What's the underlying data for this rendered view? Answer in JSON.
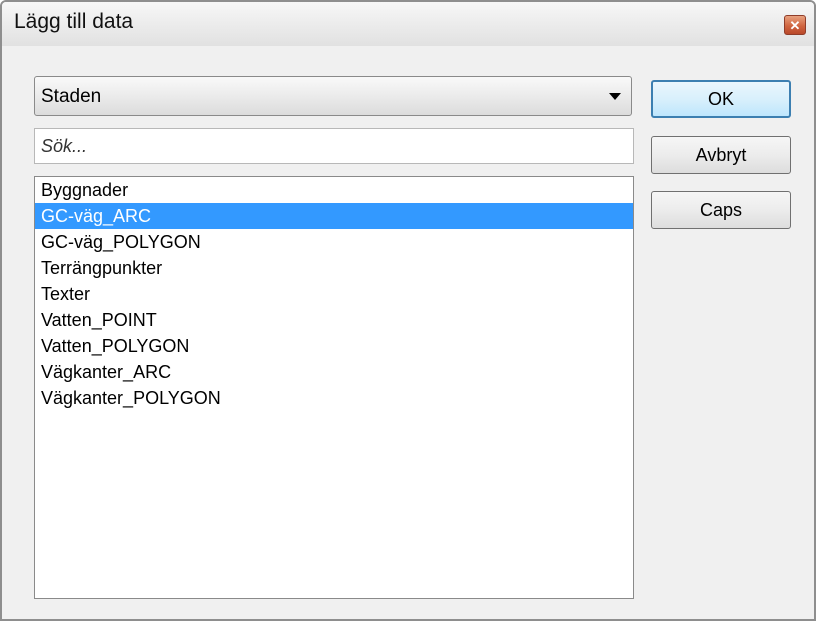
{
  "window": {
    "title": "Lägg till data",
    "close_symbol": "✕"
  },
  "source_combo": {
    "selected_value": "Staden"
  },
  "search": {
    "placeholder": "Sök...",
    "value": ""
  },
  "layer_list": {
    "items": [
      {
        "label": "Byggnader"
      },
      {
        "label": "GC-väg_ARC"
      },
      {
        "label": "GC-väg_POLYGON"
      },
      {
        "label": "Terrängpunkter"
      },
      {
        "label": "Texter"
      },
      {
        "label": "Vatten_POINT"
      },
      {
        "label": "Vatten_POLYGON"
      },
      {
        "label": "Vägkanter_ARC"
      },
      {
        "label": "Vägkanter_POLYGON"
      }
    ],
    "selected_index": 1
  },
  "buttons": {
    "ok_label": "OK",
    "cancel_label": "Avbryt",
    "caps_label": "Caps"
  },
  "colors": {
    "selection": "#3399ff",
    "default_button_border": "#3c7fb1",
    "close_button": "#d06540"
  }
}
